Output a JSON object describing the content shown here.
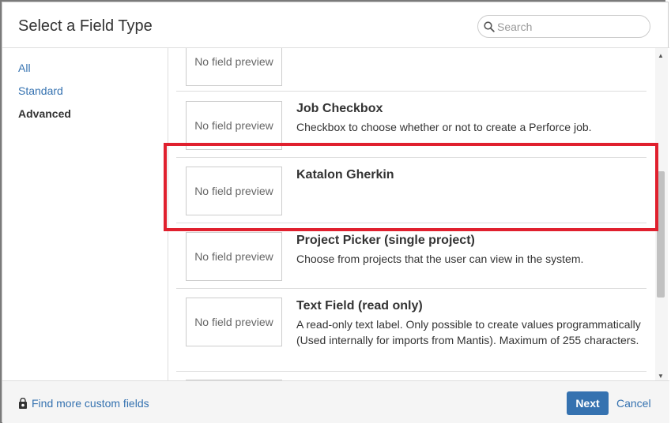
{
  "dialog": {
    "title": "Select a Field Type",
    "search": {
      "placeholder": "Search",
      "value": ""
    }
  },
  "sidebar": {
    "items": [
      {
        "label": "All",
        "active": false
      },
      {
        "label": "Standard",
        "active": false
      },
      {
        "label": "Advanced",
        "active": true
      }
    ]
  },
  "fields": [
    {
      "preview": "No field preview",
      "title": "",
      "description": ""
    },
    {
      "preview": "No field preview",
      "title": "Job Checkbox",
      "description": "Checkbox to choose whether or not to create a Perforce job."
    },
    {
      "preview": "No field preview",
      "title": "Katalon Gherkin",
      "description": ""
    },
    {
      "preview": "No field preview",
      "title": "Project Picker (single project)",
      "description": "Choose from projects that the user can view in the system."
    },
    {
      "preview": "No field preview",
      "title": "Text Field (read only)",
      "description": "A read-only text label. Only possible to create values programmatically (Used internally for imports from Mantis). Maximum of 255 characters."
    }
  ],
  "footer": {
    "find_more_label": "Find more custom fields",
    "next_label": "Next",
    "cancel_label": "Cancel"
  },
  "colors": {
    "link": "#3572b0",
    "primary_button": "#3572b0",
    "highlight_border": "#e0202e"
  },
  "icons": {
    "search": "search-icon",
    "marketplace": "shopping-bag-icon"
  }
}
